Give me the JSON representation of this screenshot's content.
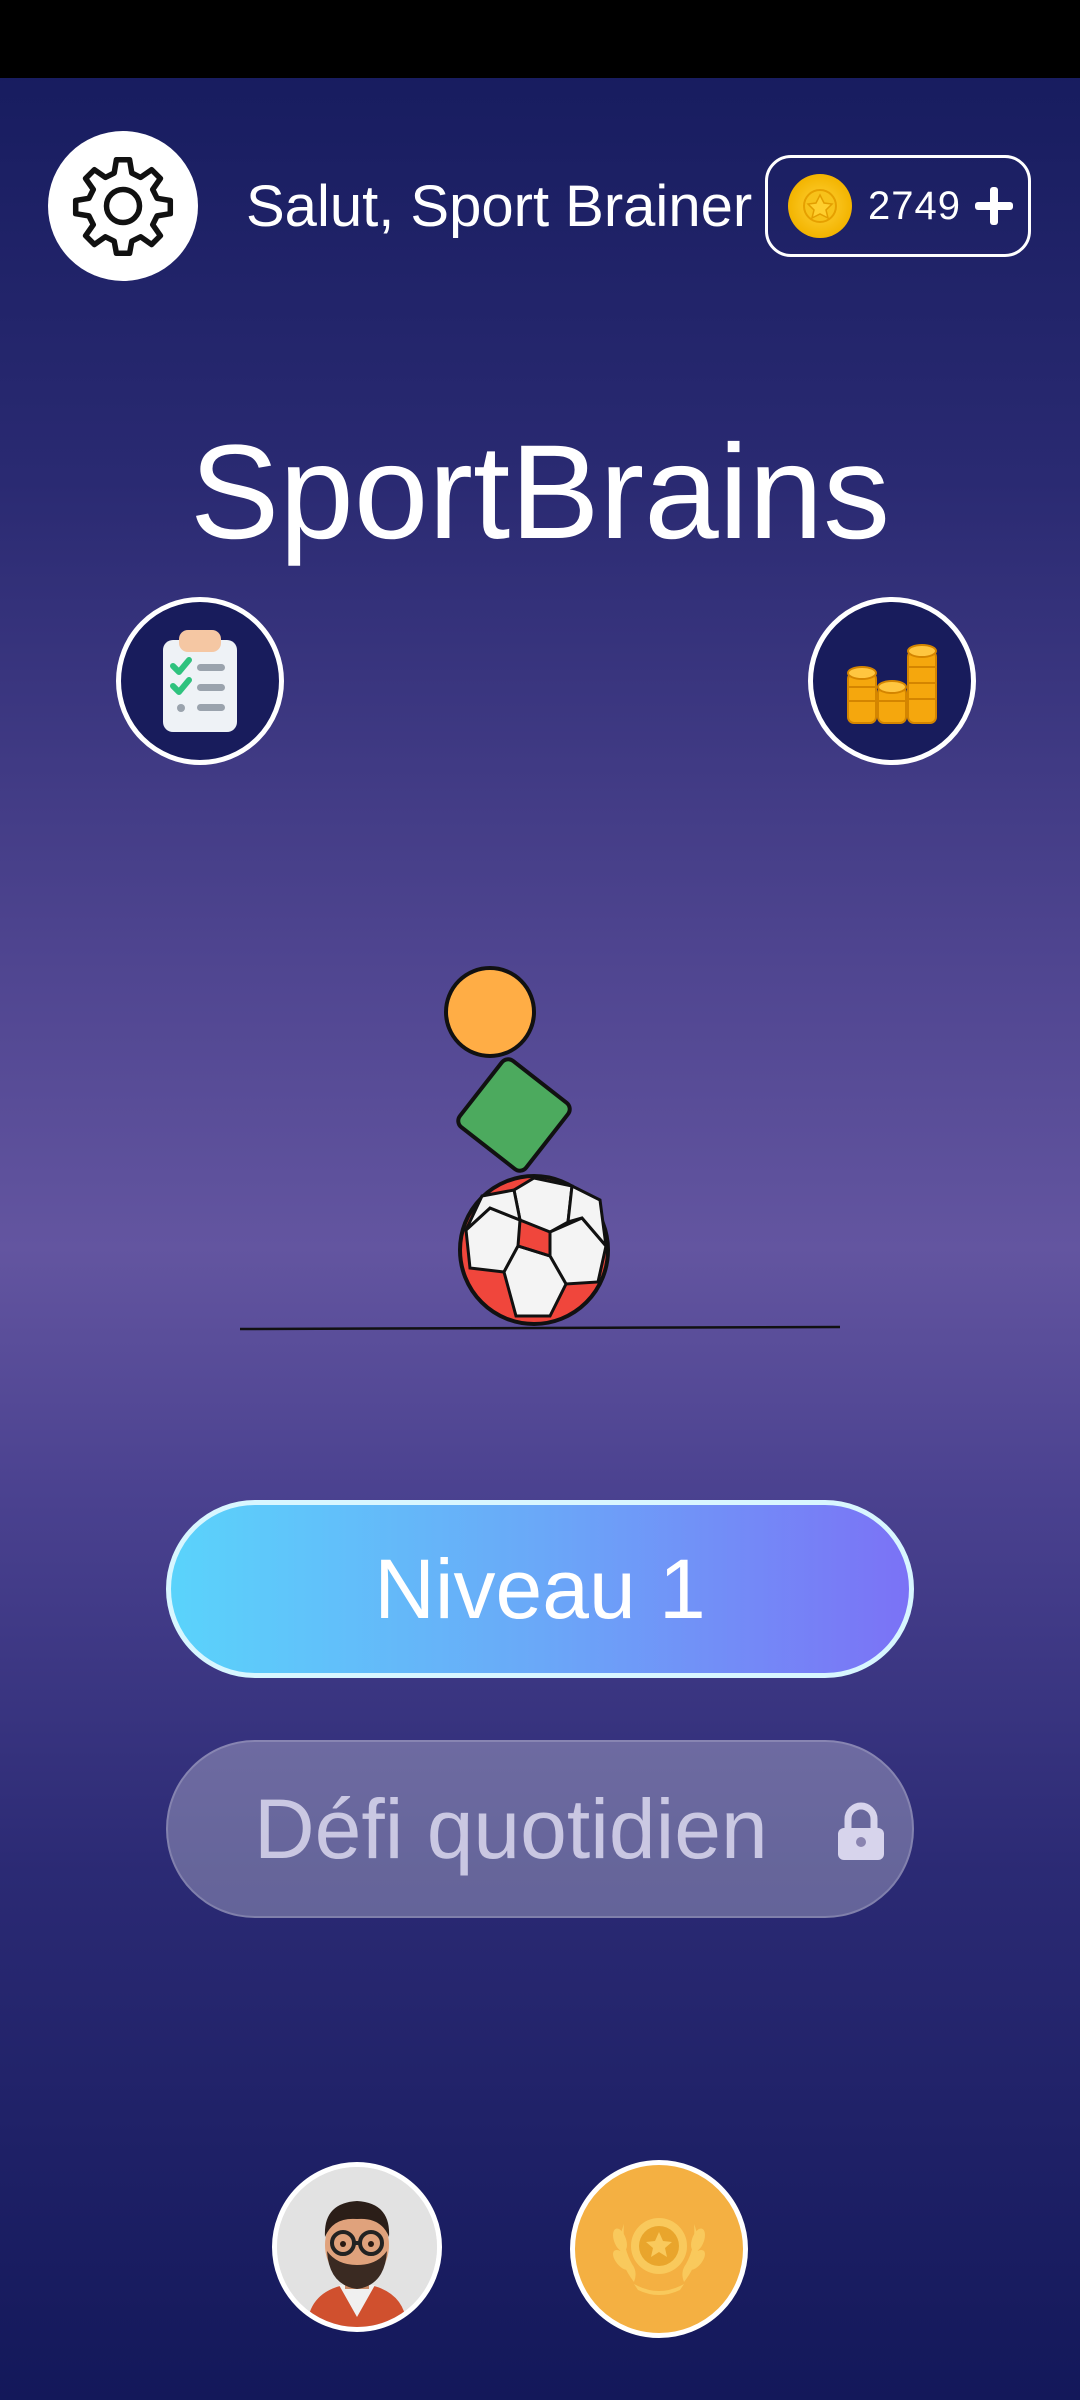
{
  "header": {
    "greeting": "Salut, Sport Brainer",
    "coins": "2749"
  },
  "title": "SportBrains",
  "buttons": {
    "level": "Niveau 1",
    "daily_challenge": "Défi quotidien"
  },
  "icons": {
    "settings": "gear-icon",
    "coin": "coin-icon",
    "add": "plus-icon",
    "tasks": "clipboard-checklist-icon",
    "stats": "coin-stacks-icon",
    "lock": "lock-icon",
    "profile": "avatar",
    "achievements": "laurel-medal-icon"
  },
  "colors": {
    "coin": "#f3b400",
    "primary_gradient_start": "#5ad3fb",
    "primary_gradient_end": "#7b72f6",
    "ball_red": "#f0463c",
    "box_green": "#4caa5e",
    "circle_orange": "#ffad45",
    "trophy_bg": "#f4b042"
  }
}
